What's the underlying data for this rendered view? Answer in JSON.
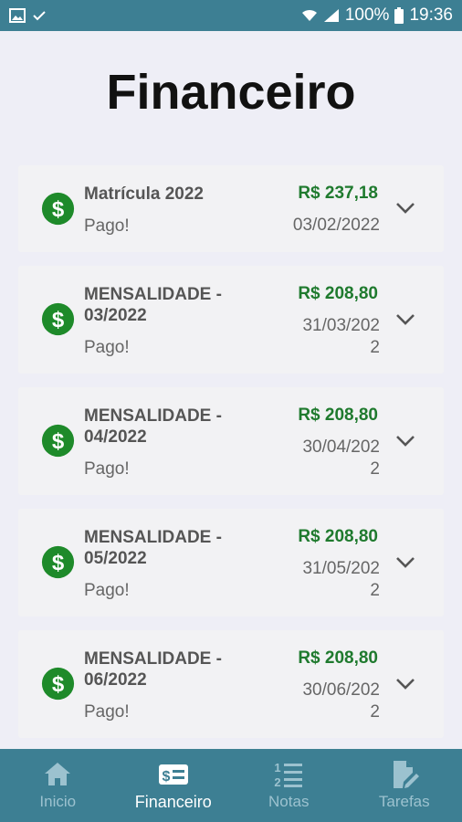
{
  "status_bar": {
    "battery": "100%",
    "time": "19:36"
  },
  "header": {
    "title": "Financeiro"
  },
  "payments": [
    {
      "name": "Matrícula 2022",
      "amount": "R$ 237,18",
      "date": "03/02/2022",
      "status": "Pago!"
    },
    {
      "name": "MENSALIDADE - 03/2022",
      "amount": "R$ 208,80",
      "date": "31/03/2022",
      "status": "Pago!"
    },
    {
      "name": "MENSALIDADE - 04/2022",
      "amount": "R$ 208,80",
      "date": "30/04/2022",
      "status": "Pago!"
    },
    {
      "name": "MENSALIDADE - 05/2022",
      "amount": "R$ 208,80",
      "date": "31/05/2022",
      "status": "Pago!"
    },
    {
      "name": "MENSALIDADE - 06/2022",
      "amount": "R$ 208,80",
      "date": "30/06/2022",
      "status": "Pago!"
    }
  ],
  "nav": {
    "items": [
      {
        "label": "Inicio",
        "icon": "home-icon"
      },
      {
        "label": "Financeiro",
        "icon": "money-icon",
        "active": true
      },
      {
        "label": "Notas",
        "icon": "list-numbered-icon"
      },
      {
        "label": "Tarefas",
        "icon": "document-edit-icon"
      }
    ]
  },
  "colors": {
    "primary": "#3d7f93",
    "money_green": "#1f7a2e",
    "coin_green": "#1e8a2a"
  }
}
